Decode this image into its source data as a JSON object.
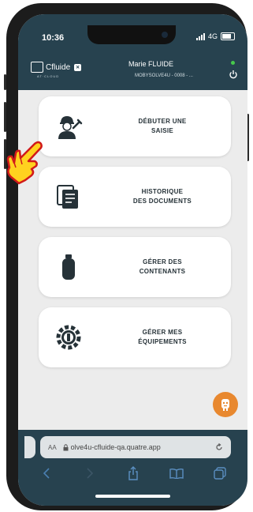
{
  "status": {
    "time": "10:36",
    "network": "4G"
  },
  "header": {
    "logo_text": "Cfluide",
    "logo_badge": "✕",
    "logo_sub": "AT·CLOUD",
    "user_name": "Marie FLUIDE",
    "user_sub": "MOBYSOLVE4U - 0008 - ..."
  },
  "menu": [
    {
      "label": "DÉBUTER UNE\nSAISIE",
      "icon": "technician-icon"
    },
    {
      "label": "HISTORIQUE\nDES DOCUMENTS",
      "icon": "documents-icon"
    },
    {
      "label": "GÉRER DES\nCONTENANTS",
      "icon": "gas-cylinder-icon"
    },
    {
      "label": "GÉRER MES\nÉQUIPEMENTS",
      "icon": "equipment-gear-icon"
    }
  ],
  "browser": {
    "aa": "AA",
    "url": "olve4u-cfluide-qa.quatre.app"
  },
  "colors": {
    "header": "#27424f",
    "fab": "#e8882f",
    "card_text": "#263238"
  }
}
